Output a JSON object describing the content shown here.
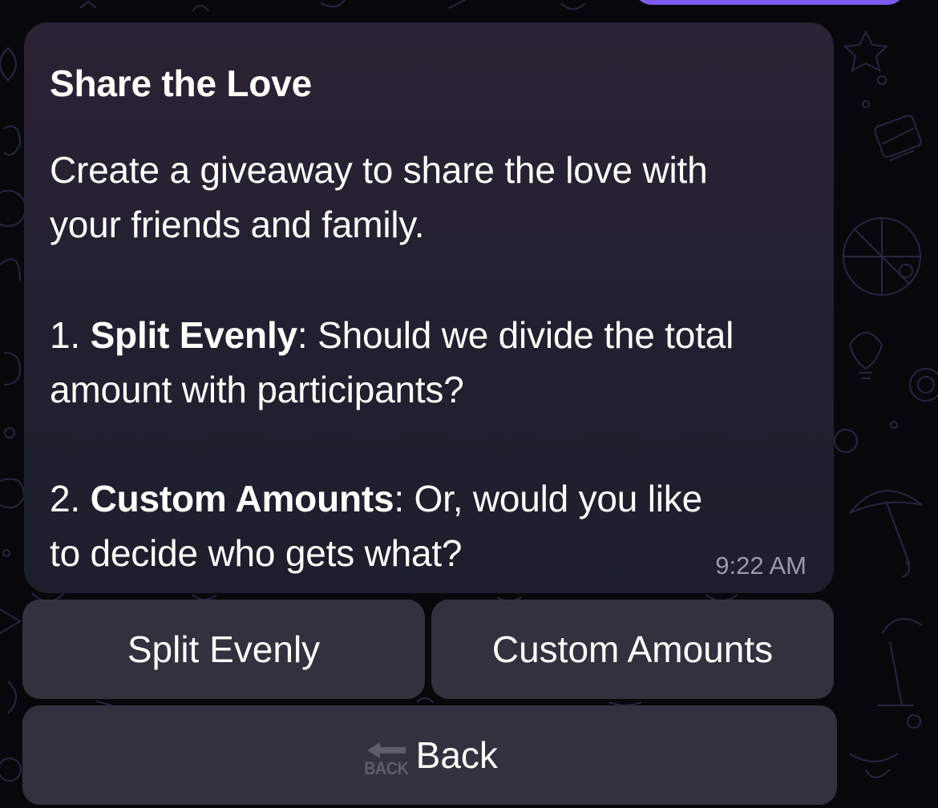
{
  "message": {
    "title": "Share the Love",
    "intro_line1": "Create a giveaway to share the love with",
    "intro_line2": "your friends and family.",
    "item1_number": "1.",
    "item1_heading": "Split Evenly",
    "item1_rest_line1": ": Should we divide the total",
    "item1_line2": "amount with participants?",
    "item2_number": "2.",
    "item2_heading": "Custom Amounts",
    "item2_rest_line1": ": Or, would you like",
    "item2_line2": "to decide who gets what?",
    "time": "9:22 AM"
  },
  "keyboard": {
    "split_label": "Split Evenly",
    "custom_label": "Custom Amounts",
    "back_label": "Back",
    "back_icon_text": "BACK"
  },
  "colors": {
    "background": "#08080c",
    "bubble": "#25212f",
    "button": "#343442",
    "accent": "#7d5bf0",
    "timestamp": "#9a9aa8"
  },
  "icons": {
    "back": "back-arrow-icon"
  }
}
